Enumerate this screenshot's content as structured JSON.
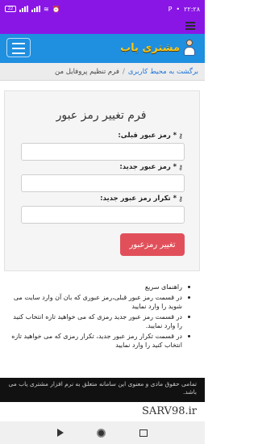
{
  "status_bar": {
    "battery": "22",
    "icons_left": [
      "signal-bars-icon",
      "signal-bars-icon",
      "wifi-icon",
      "alarm-icon"
    ],
    "time": "۲۲:۲۸",
    "indicator": "P"
  },
  "navbar": {
    "brand": "مشتری یاب"
  },
  "breadcrumb": {
    "back_link": "برگشت به محیط کاربری",
    "separator": "/",
    "current": "فرم تنظیم پروفایل من"
  },
  "form": {
    "title": "فرم تغییر رمز عبور",
    "fields": [
      {
        "label": "* رمز عبور قبلی:",
        "value": ""
      },
      {
        "label": "* رمز عبور جدید:",
        "value": ""
      },
      {
        "label": "* تکرار رمز عبور جدید:",
        "value": ""
      }
    ],
    "submit_label": "تغییر رمزعبور"
  },
  "help": [
    "راهنمای سریع",
    "در قسمت رمز عبور قبلی،رمز عبوری که بان آن وارد سایت می شوید را وارد نمایید",
    "در قسمت رمز عبور جدید رمزی که می خواهید تازه انتخاب کنید را وارد نمایید.",
    "در قسمت تکرار رمز عبور جدید، تکرار رمزی که می خواهید تازه انتخاب کنید را وارد نمایید"
  ],
  "footer": {
    "text": "تمامی حقوق مادی و معنوی این سامانه متعلق به نرم افزار مشتری یاب می باشد."
  },
  "watermark": "SARV98.ir",
  "colors": {
    "status_purple": "#8a16e6",
    "navbar_blue": "#1f8fe0",
    "brand_yellow": "#f5c518",
    "submit_red": "#e1505a",
    "link_blue": "#1a73d9"
  }
}
